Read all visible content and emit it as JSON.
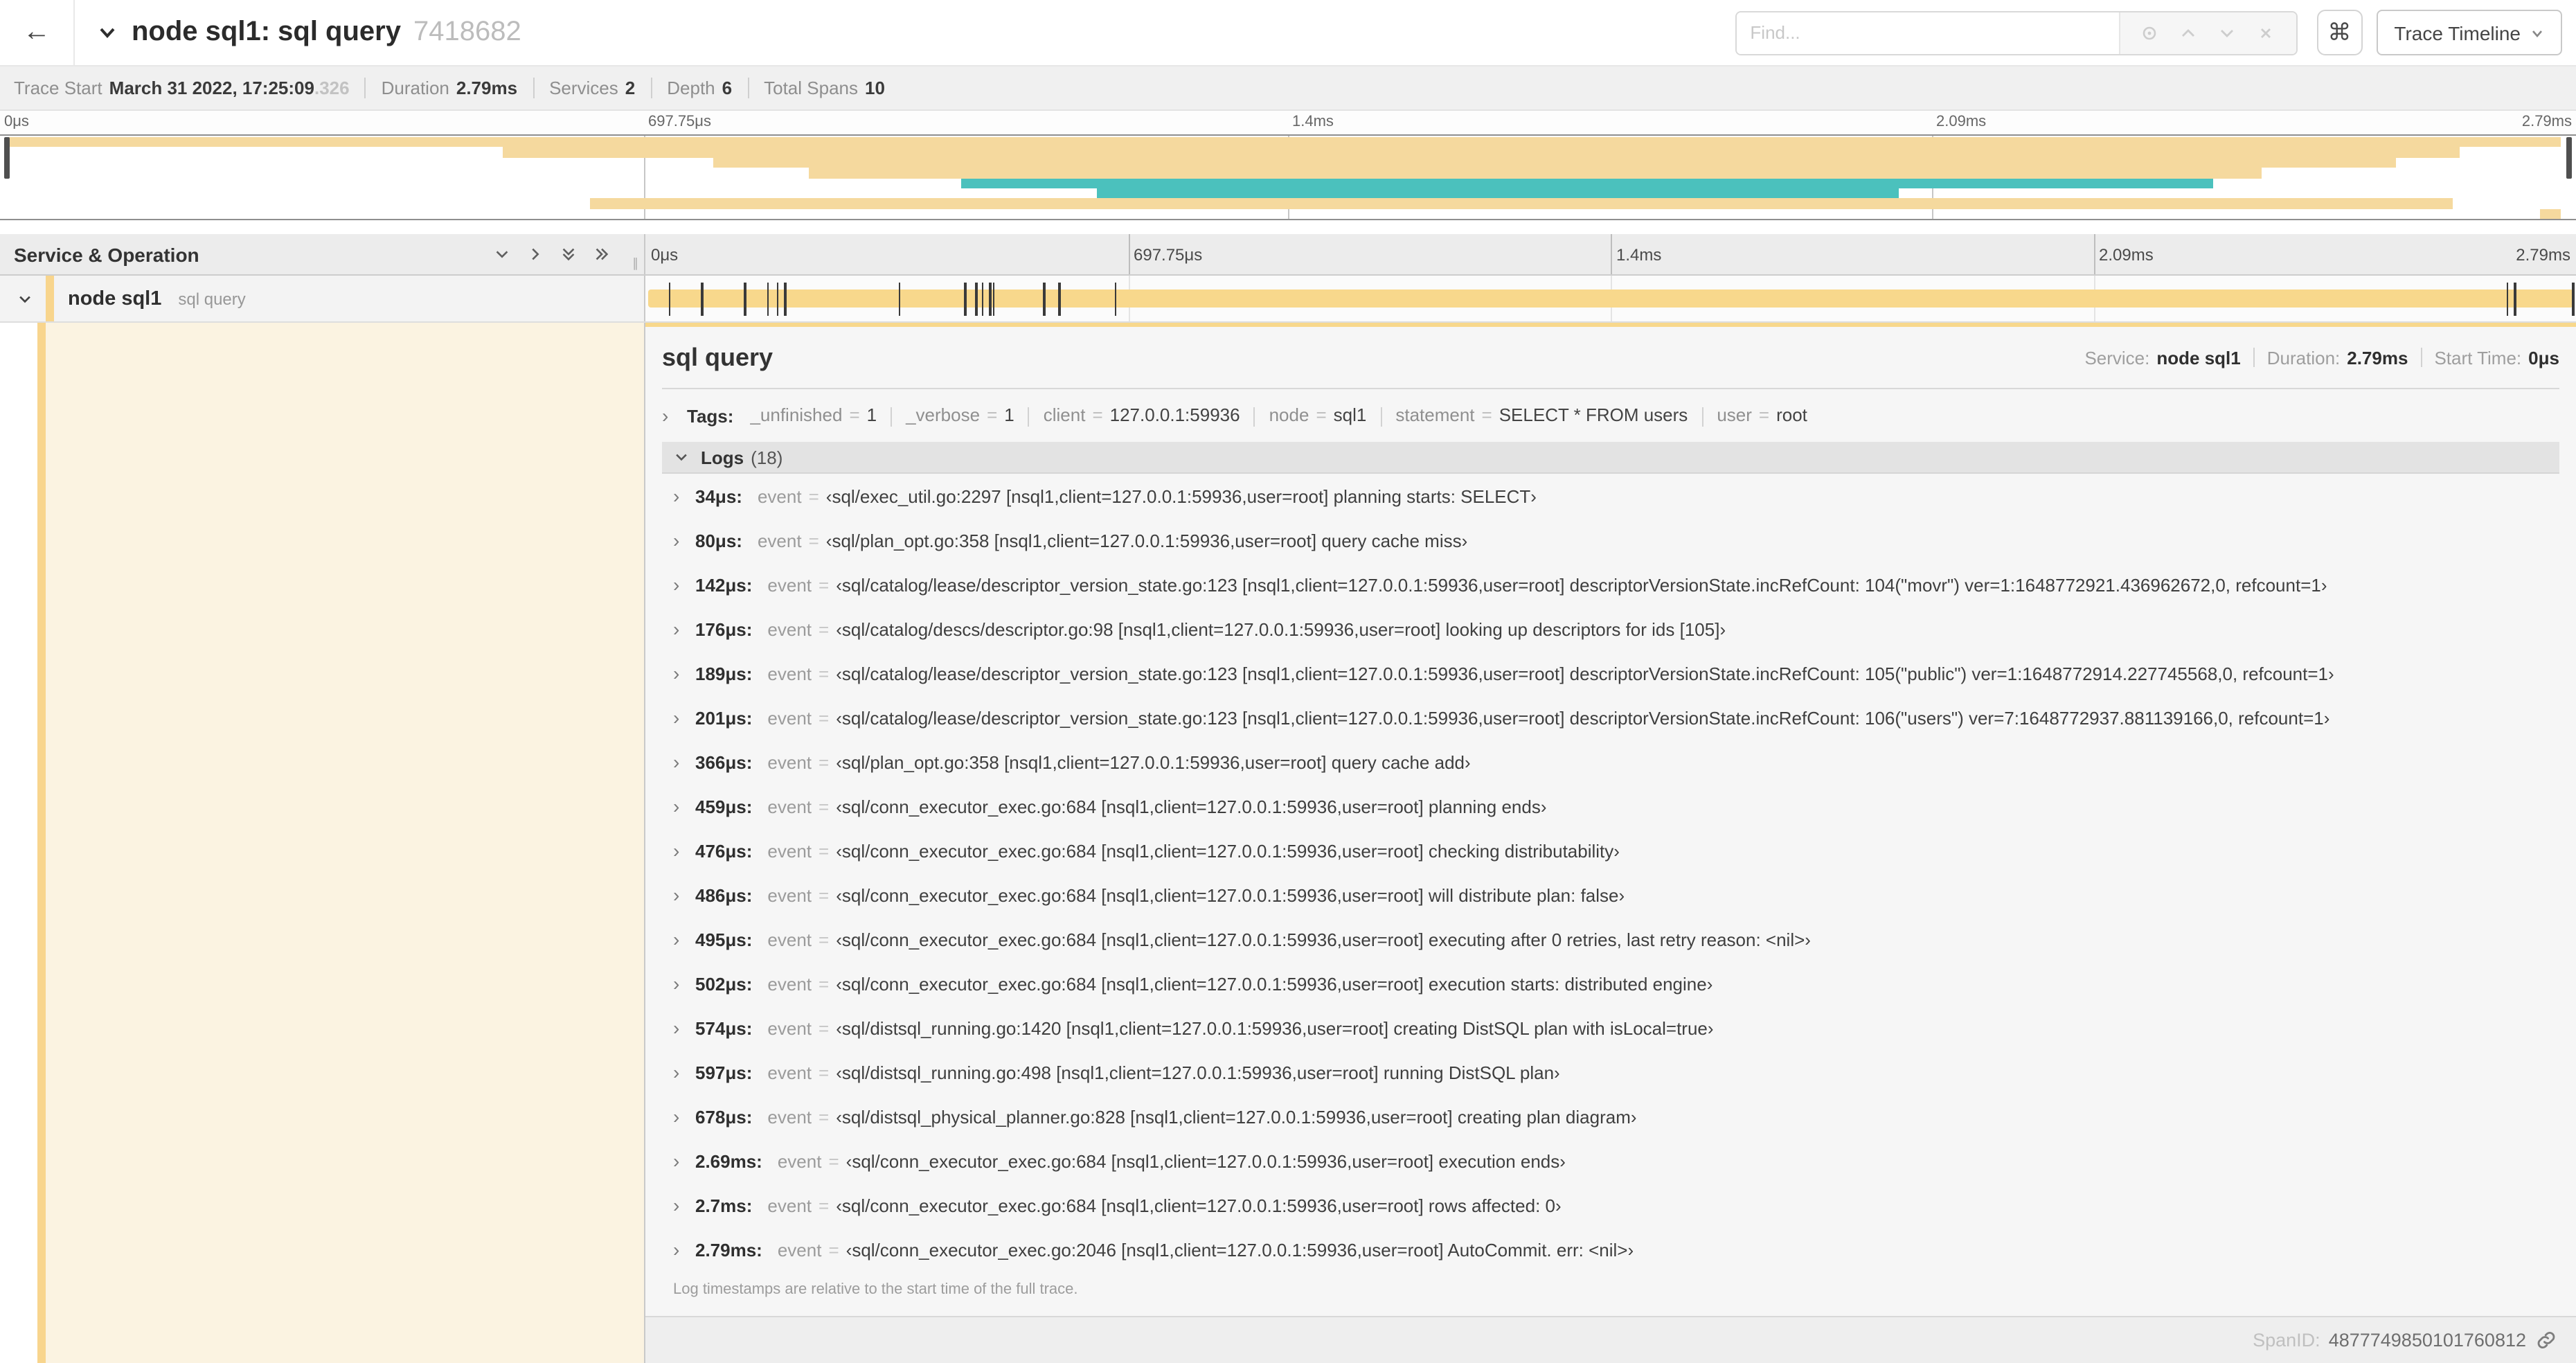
{
  "header": {
    "back_icon": "←",
    "title": "node sql1: sql query",
    "trace_id": "7418682",
    "find_placeholder": "Find...",
    "shortcuts_glyph": "⌘",
    "view_selector": "Trace Timeline"
  },
  "meta": {
    "trace_start_label": "Trace Start",
    "trace_start_value": "March 31 2022, 17:25:09",
    "trace_start_fraction": ".326",
    "duration_label": "Duration",
    "duration_value": "2.79ms",
    "services_label": "Services",
    "services_value": "2",
    "depth_label": "Depth",
    "depth_value": "6",
    "total_spans_label": "Total Spans",
    "total_spans_value": "10"
  },
  "timeline": {
    "left_header": "Service & Operation",
    "ticks": [
      {
        "pct": 0,
        "label": "0μs"
      },
      {
        "pct": 25,
        "label": "697.75μs"
      },
      {
        "pct": 50,
        "label": "1.4ms"
      },
      {
        "pct": 75,
        "label": "2.09ms"
      },
      {
        "pct": 100,
        "label": "2.79ms"
      }
    ],
    "gridlines_pct": [
      25,
      50,
      75
    ]
  },
  "minimap": {
    "spans": [
      {
        "start_pct": 0.2,
        "end_pct": 99.4,
        "color": "tan"
      },
      {
        "start_pct": 19.5,
        "end_pct": 95.5,
        "color": "tan"
      },
      {
        "start_pct": 27.7,
        "end_pct": 93.0,
        "color": "tan"
      },
      {
        "start_pct": 31.4,
        "end_pct": 87.8,
        "color": "tan"
      },
      {
        "start_pct": 37.3,
        "end_pct": 85.9,
        "color": "teal"
      },
      {
        "start_pct": 42.6,
        "end_pct": 73.7,
        "color": "teal"
      },
      {
        "start_pct": 22.9,
        "end_pct": 95.2,
        "color": "tan"
      },
      {
        "start_pct": 98.6,
        "end_pct": 99.4,
        "color": "tan"
      }
    ]
  },
  "span_row": {
    "service": "node sql1",
    "operation": "sql query",
    "bar_start_pct": 0.15,
    "bar_end_pct": 99.85,
    "log_marks_pct": [
      1.2,
      2.9,
      5.1,
      6.3,
      6.8,
      7.2,
      13.1,
      16.5,
      17.1,
      17.4,
      17.8,
      18.0,
      20.6,
      21.4,
      24.3,
      96.4,
      96.8,
      99.8
    ]
  },
  "detail": {
    "title": "sql query",
    "stats": [
      {
        "label": "Service:",
        "value": "node sql1"
      },
      {
        "label": "Duration:",
        "value": "2.79ms"
      },
      {
        "label": "Start Time:",
        "value": "0μs"
      }
    ],
    "tags_label": "Tags:",
    "tags": [
      {
        "key": "_unfinished",
        "value": "1"
      },
      {
        "key": "_verbose",
        "value": "1"
      },
      {
        "key": "client",
        "value": "127.0.0.1:59936"
      },
      {
        "key": "node",
        "value": "sql1"
      },
      {
        "key": "statement",
        "value": "SELECT * FROM users"
      },
      {
        "key": "user",
        "value": "root"
      }
    ],
    "logs_label": "Logs",
    "logs_count": "(18)",
    "logs": [
      {
        "time": "34μs:",
        "key": "event",
        "value": "‹sql/exec_util.go:2297 [nsql1,client=127.0.0.1:59936,user=root] planning starts: SELECT›"
      },
      {
        "time": "80μs:",
        "key": "event",
        "value": "‹sql/plan_opt.go:358 [nsql1,client=127.0.0.1:59936,user=root] query cache miss›"
      },
      {
        "time": "142μs:",
        "key": "event",
        "value": "‹sql/catalog/lease/descriptor_version_state.go:123 [nsql1,client=127.0.0.1:59936,user=root] descriptorVersionState.incRefCount: 104(\"movr\") ver=1:1648772921.436962672,0, refcount=1›"
      },
      {
        "time": "176μs:",
        "key": "event",
        "value": "‹sql/catalog/descs/descriptor.go:98 [nsql1,client=127.0.0.1:59936,user=root] looking up descriptors for ids [105]›"
      },
      {
        "time": "189μs:",
        "key": "event",
        "value": "‹sql/catalog/lease/descriptor_version_state.go:123 [nsql1,client=127.0.0.1:59936,user=root] descriptorVersionState.incRefCount: 105(\"public\") ver=1:1648772914.227745568,0, refcount=1›"
      },
      {
        "time": "201μs:",
        "key": "event",
        "value": "‹sql/catalog/lease/descriptor_version_state.go:123 [nsql1,client=127.0.0.1:59936,user=root] descriptorVersionState.incRefCount: 106(\"users\") ver=7:1648772937.881139166,0, refcount=1›"
      },
      {
        "time": "366μs:",
        "key": "event",
        "value": "‹sql/plan_opt.go:358 [nsql1,client=127.0.0.1:59936,user=root] query cache add›"
      },
      {
        "time": "459μs:",
        "key": "event",
        "value": "‹sql/conn_executor_exec.go:684 [nsql1,client=127.0.0.1:59936,user=root] planning ends›"
      },
      {
        "time": "476μs:",
        "key": "event",
        "value": "‹sql/conn_executor_exec.go:684 [nsql1,client=127.0.0.1:59936,user=root] checking distributability›"
      },
      {
        "time": "486μs:",
        "key": "event",
        "value": "‹sql/conn_executor_exec.go:684 [nsql1,client=127.0.0.1:59936,user=root] will distribute plan: false›"
      },
      {
        "time": "495μs:",
        "key": "event",
        "value": "‹sql/conn_executor_exec.go:684 [nsql1,client=127.0.0.1:59936,user=root] executing after 0 retries, last retry reason: <nil>›"
      },
      {
        "time": "502μs:",
        "key": "event",
        "value": "‹sql/conn_executor_exec.go:684 [nsql1,client=127.0.0.1:59936,user=root] execution starts: distributed engine›"
      },
      {
        "time": "574μs:",
        "key": "event",
        "value": "‹sql/distsql_running.go:1420 [nsql1,client=127.0.0.1:59936,user=root] creating DistSQL plan with isLocal=true›"
      },
      {
        "time": "597μs:",
        "key": "event",
        "value": "‹sql/distsql_running.go:498 [nsql1,client=127.0.0.1:59936,user=root] running DistSQL plan›"
      },
      {
        "time": "678μs:",
        "key": "event",
        "value": "‹sql/distsql_physical_planner.go:828 [nsql1,client=127.0.0.1:59936,user=root] creating plan diagram›"
      },
      {
        "time": "2.69ms:",
        "key": "event",
        "value": "‹sql/conn_executor_exec.go:684 [nsql1,client=127.0.0.1:59936,user=root] execution ends›"
      },
      {
        "time": "2.7ms:",
        "key": "event",
        "value": "‹sql/conn_executor_exec.go:684 [nsql1,client=127.0.0.1:59936,user=root] rows affected: 0›"
      },
      {
        "time": "2.79ms:",
        "key": "event",
        "value": "‹sql/conn_executor_exec.go:2046 [nsql1,client=127.0.0.1:59936,user=root] AutoCommit. err: <nil>›"
      }
    ],
    "footnote": "Log timestamps are relative to the start time of the full trace.",
    "span_id_label": "SpanID:",
    "span_id": "4877749850101760812"
  },
  "colors": {
    "tan": "#f5d99e",
    "tan_bar": "#f8d88c",
    "teal": "#4bc1bd",
    "cream": "#fbf3e1"
  }
}
